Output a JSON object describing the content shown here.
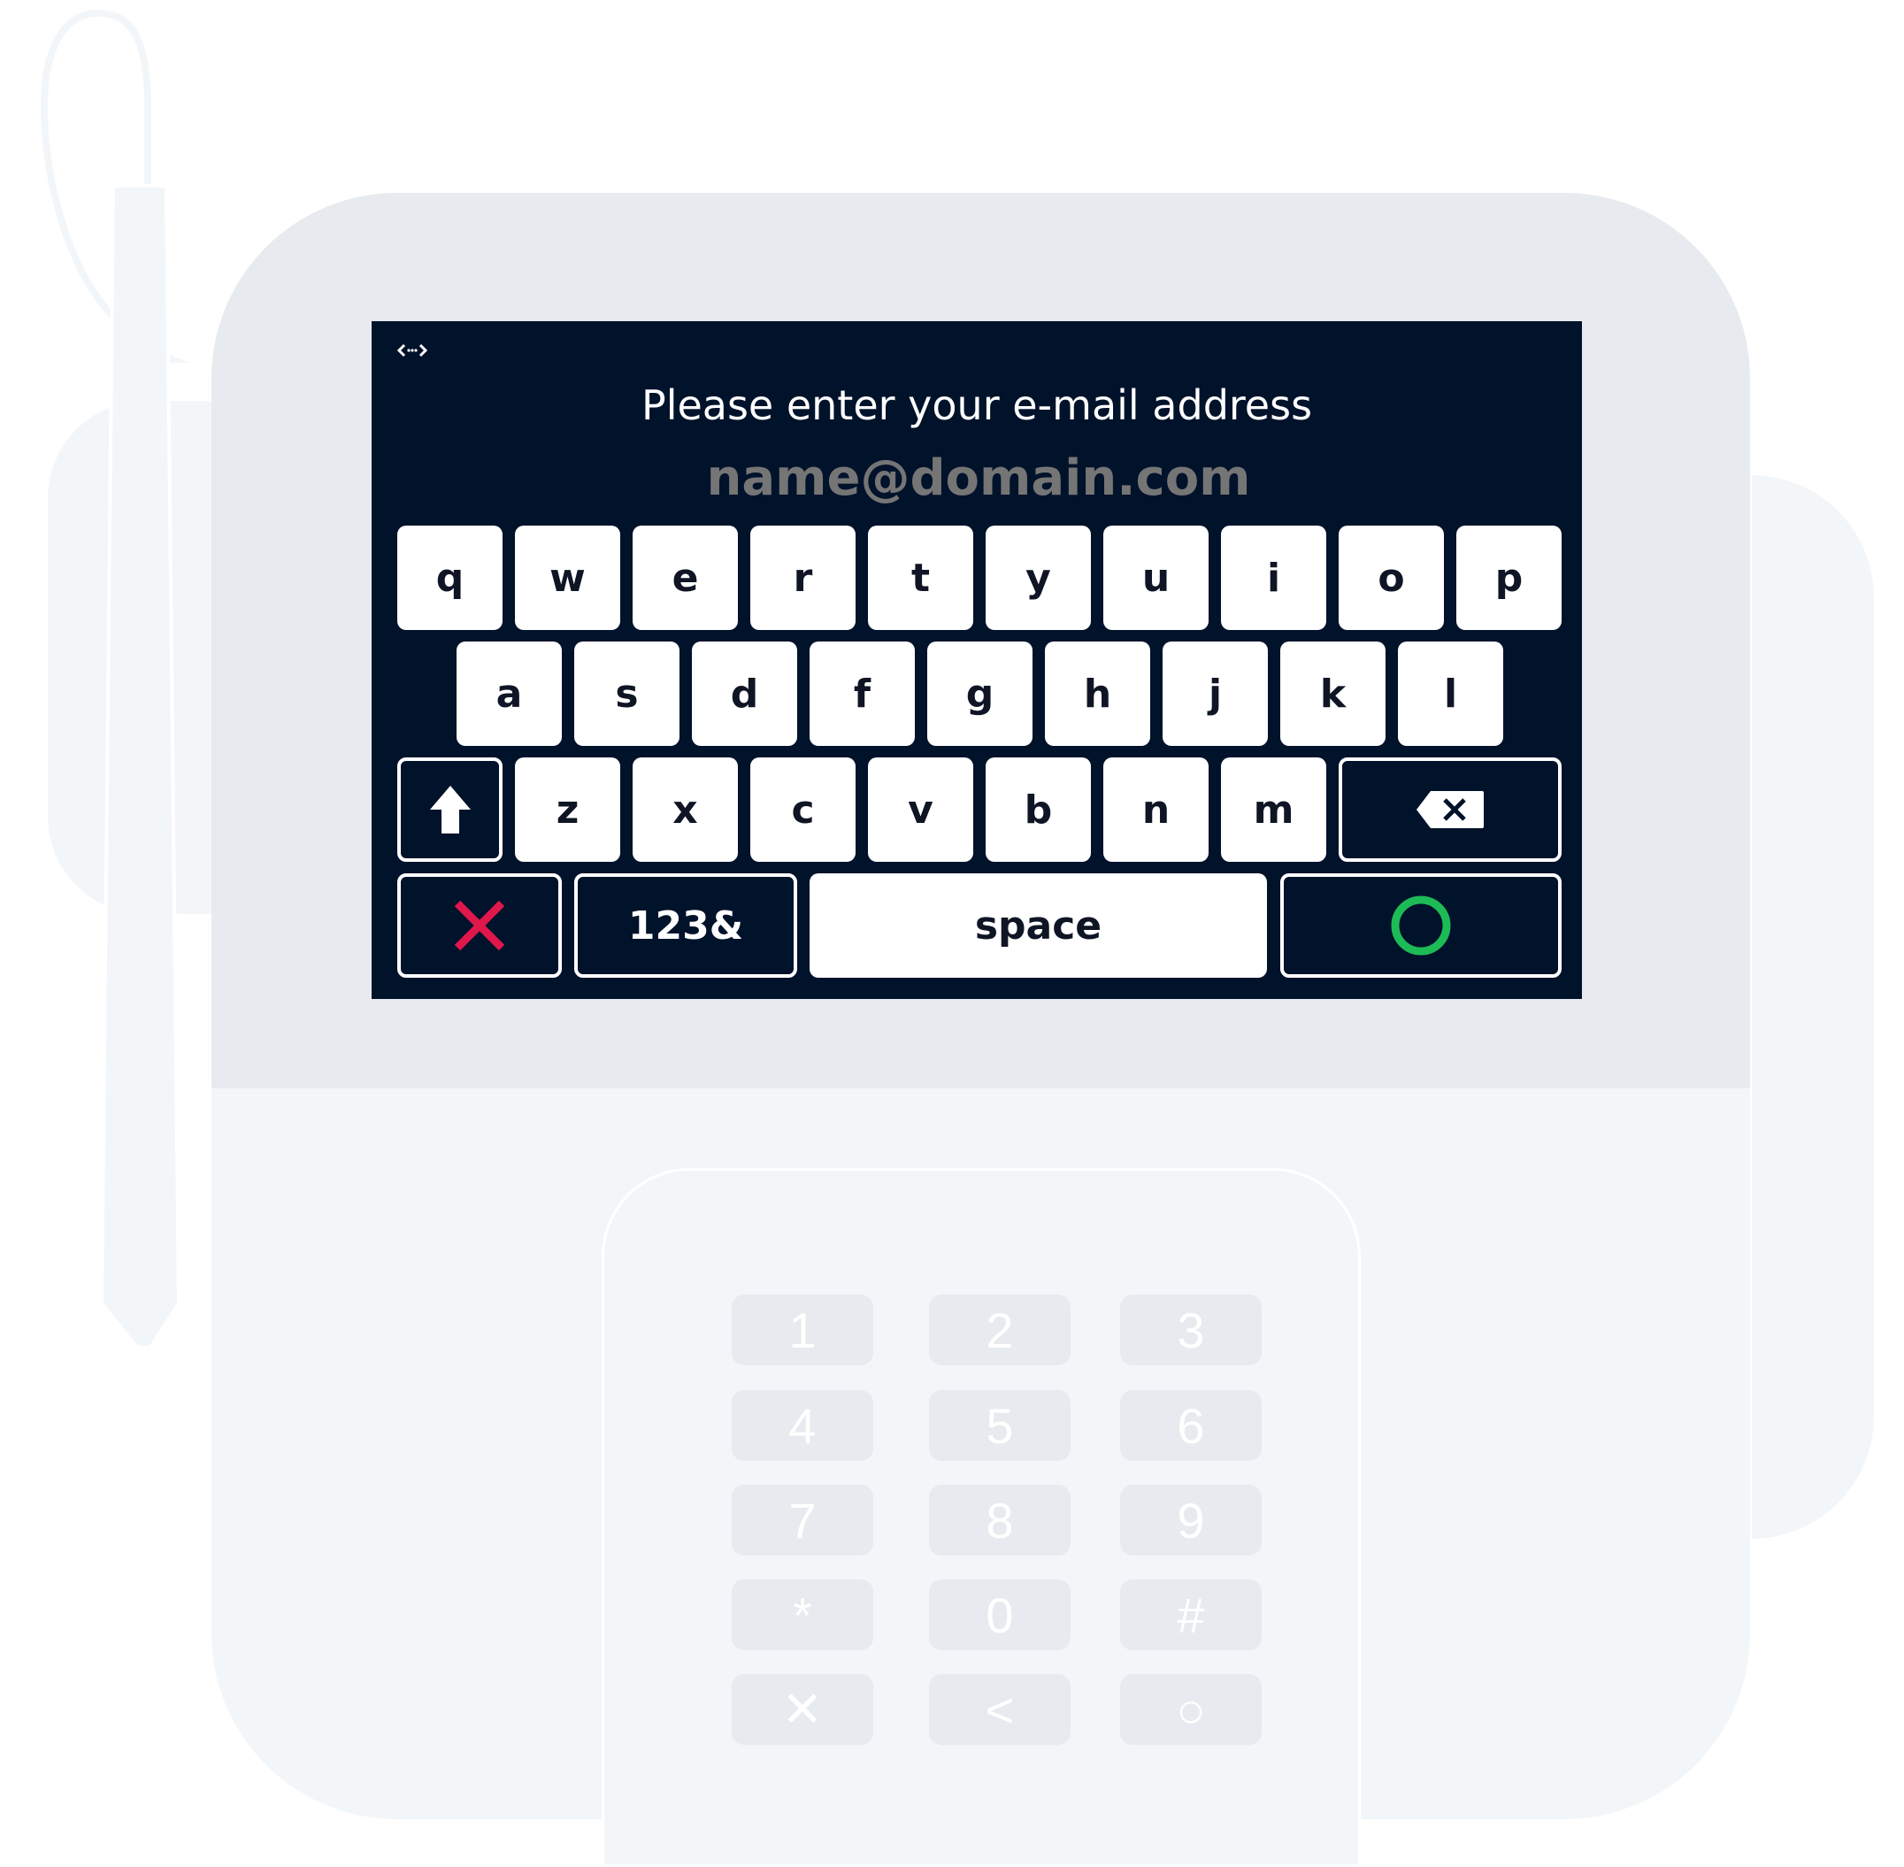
{
  "screen": {
    "back_icon": "code-arrows-icon",
    "prompt": "Please enter your e-mail address",
    "email_placeholder": "name@domain.com",
    "email_value": ""
  },
  "keyboard": {
    "row1": [
      "q",
      "w",
      "e",
      "r",
      "t",
      "y",
      "u",
      "i",
      "o",
      "p"
    ],
    "row2": [
      "a",
      "s",
      "d",
      "f",
      "g",
      "h",
      "j",
      "k",
      "l"
    ],
    "row3": [
      "z",
      "x",
      "c",
      "v",
      "b",
      "n",
      "m"
    ],
    "shift_icon": "shift-arrow-icon",
    "backspace_icon": "backspace-icon",
    "cancel_icon": "cancel-x-icon",
    "numbers_label": "123&",
    "space_label": "space",
    "confirm_icon": "confirm-circle-icon"
  },
  "colors": {
    "screen_bg": "#01122b",
    "cancel": "#e0174b",
    "confirm": "#1dbb55",
    "device_top": "#e7eaee",
    "device_body": "#f3f6f9"
  },
  "pinpad": {
    "keys": [
      "1",
      "2",
      "3",
      "4",
      "5",
      "6",
      "7",
      "8",
      "9",
      "*",
      "0",
      "#",
      "✕",
      "<",
      "○"
    ]
  }
}
